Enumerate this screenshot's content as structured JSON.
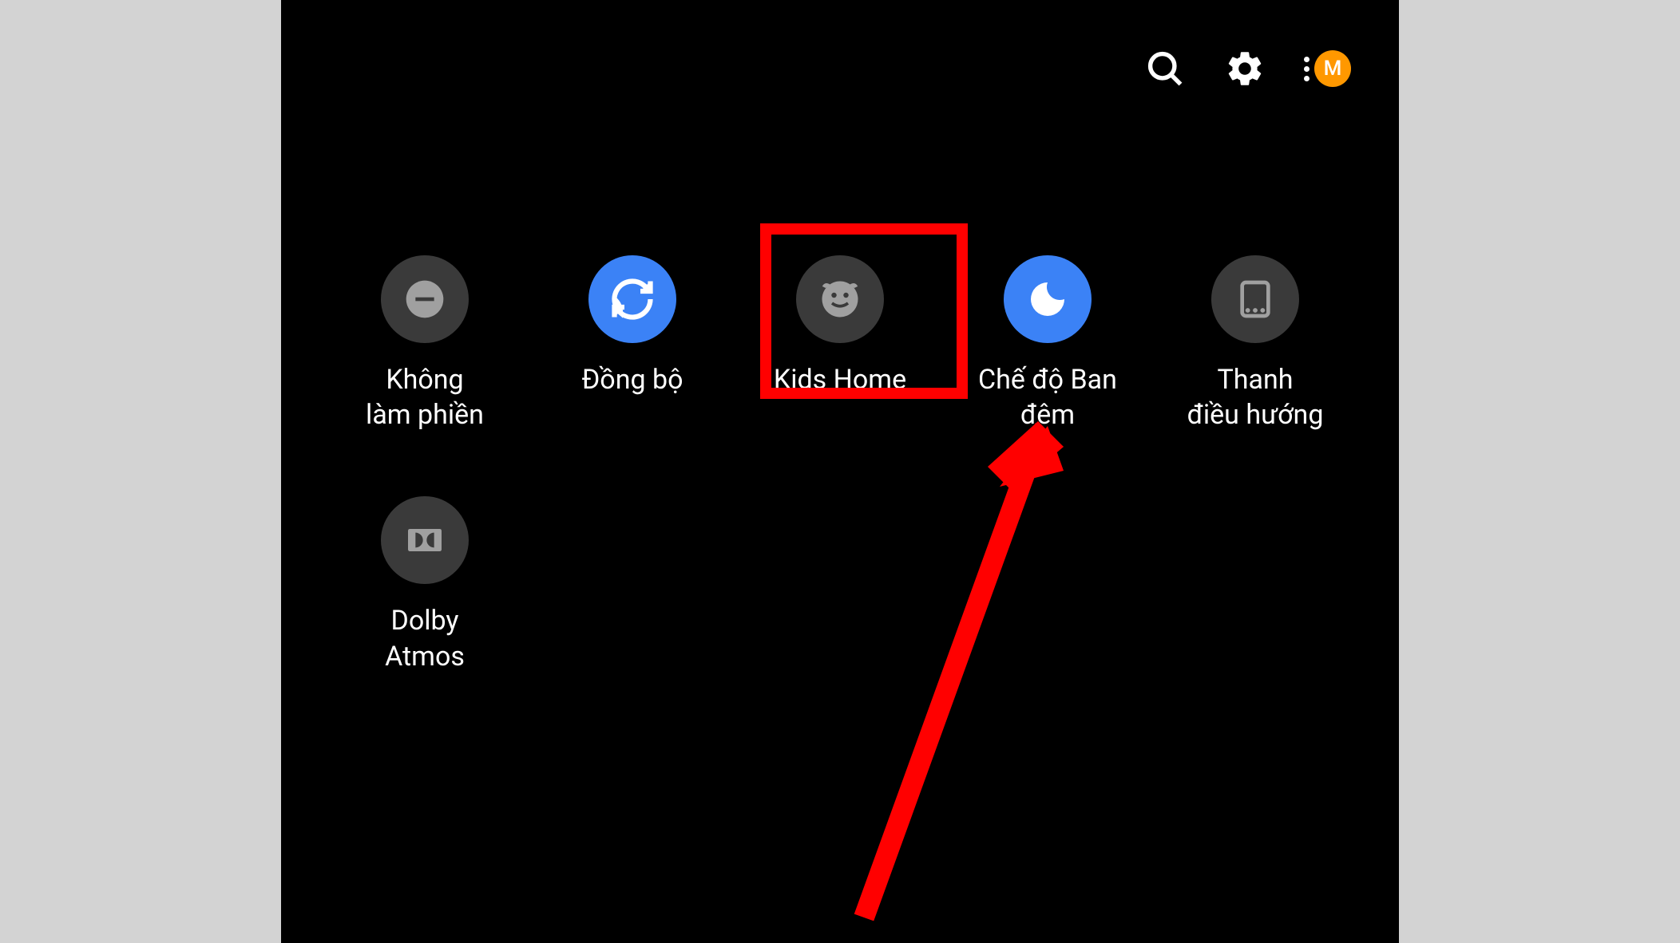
{
  "header": {
    "profile_letter": "M"
  },
  "tiles": {
    "dnd": "Không\nlàm phiền",
    "sync": "Đồng bộ",
    "kids": "Kids Home",
    "night": "Chế độ Ban\nđêm",
    "nav": "Thanh\nđiều hướng",
    "dolby": "Dolby\nAtmos"
  },
  "annotation": {
    "highlight_target": "kids-home-tile"
  }
}
